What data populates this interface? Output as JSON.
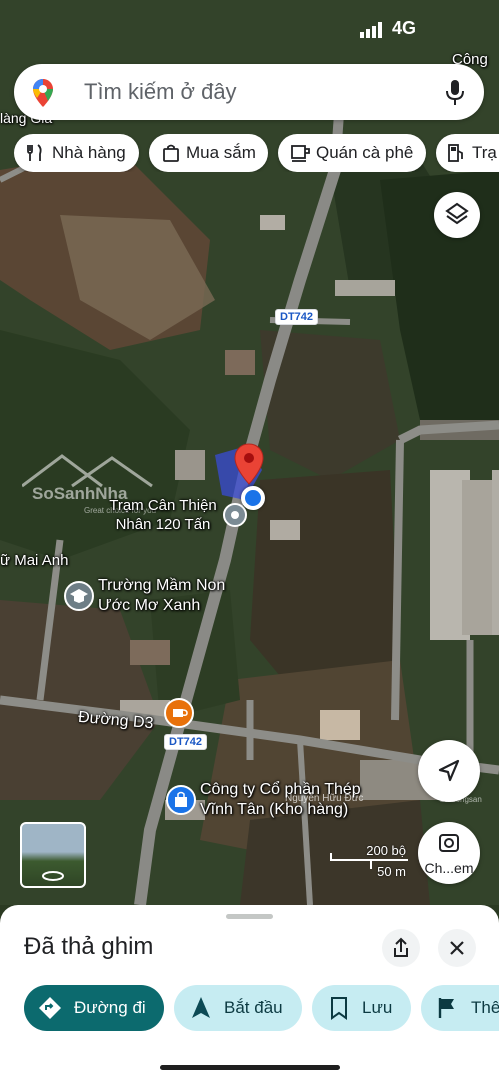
{
  "status_bar": {
    "signal": "4G"
  },
  "search": {
    "placeholder": "Tìm kiếm ở đây"
  },
  "chips": [
    {
      "label": "Nhà hàng",
      "icon": "restaurant-icon"
    },
    {
      "label": "Mua sắm",
      "icon": "shopping-bag-icon"
    },
    {
      "label": "Quán cà phê",
      "icon": "coffee-cup-icon"
    },
    {
      "label": "Trạ",
      "icon": "gas-station-icon"
    }
  ],
  "map": {
    "labels": {
      "top_right": "Công ty",
      "top_left": "làng Gia",
      "weigh_station": "Trạm Cân Thiện Nhân 120 Tấn",
      "left_edge": "ữ Mai Anh",
      "school": "Trường Mầm Non Ước Mơ Xanh",
      "road_d3": "Đường D3",
      "company": "Công ty Cổ phần Thép Vĩnh Tân (Kho hàng)",
      "watermark": "SoSanhNha",
      "watermark_tagline": "Great choice for you",
      "nguyen_huu_duc": "Nguyễn Hữu Đức",
      "corner_watermark": "batdongsan"
    },
    "road_tags": [
      "DT742",
      "DT742"
    ],
    "scale": {
      "imperial": "200 bộ",
      "metric": "50 m"
    },
    "search_area_label": "Ch...em",
    "colors": {
      "pin": "#ea4335",
      "location_dot": "#1a73e8",
      "road_tag_text": "#1a57c4"
    }
  },
  "sheet": {
    "title": "Đã thả ghim",
    "buttons": [
      {
        "label": "Đường đi",
        "icon": "directions-icon"
      },
      {
        "label": "Bắt đầu",
        "icon": "navigation-arrow-icon"
      },
      {
        "label": "Lưu",
        "icon": "bookmark-icon"
      },
      {
        "label": "Thê",
        "icon": "flag-icon"
      }
    ]
  }
}
